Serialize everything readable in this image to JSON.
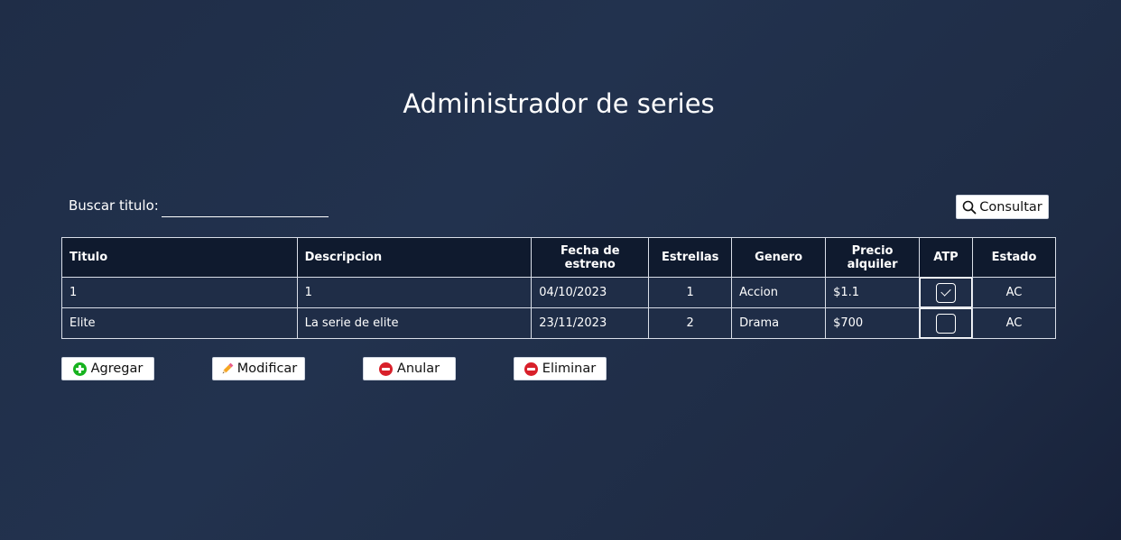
{
  "page": {
    "title": "Administrador de series"
  },
  "search": {
    "label": "Buscar titulo:",
    "value": "",
    "placeholder": "",
    "button_label": "Consultar"
  },
  "table": {
    "headers": [
      "Titulo",
      "Descripcion",
      "Fecha de estreno",
      "Estrellas",
      "Genero",
      "Precio alquiler",
      "ATP",
      "Estado"
    ],
    "rows": [
      {
        "titulo": "1",
        "descripcion": "1",
        "fecha": "04/10/2023",
        "estrellas": "1",
        "genero": "Accion",
        "precio": "$1.1",
        "atp": true,
        "estado": "AC"
      },
      {
        "titulo": "Elite",
        "descripcion": "La serie de elite",
        "fecha": "23/11/2023",
        "estrellas": "2",
        "genero": "Drama",
        "precio": "$700",
        "atp": false,
        "estado": "AC"
      }
    ]
  },
  "actions": {
    "agregar": "Agregar",
    "modificar": "Modificar",
    "anular": "Anular",
    "eliminar": "Eliminar"
  },
  "icons": {
    "consultar": "search-icon",
    "agregar": "plus-circle-icon",
    "modificar": "pencil-icon",
    "anular": "minus-circle-icon",
    "eliminar": "minus-circle-icon"
  },
  "colors": {
    "background": "#1f2d47",
    "header_row": "#0f1a2e",
    "add_icon": "#17b31f",
    "remove_icon": "#d8202a"
  }
}
